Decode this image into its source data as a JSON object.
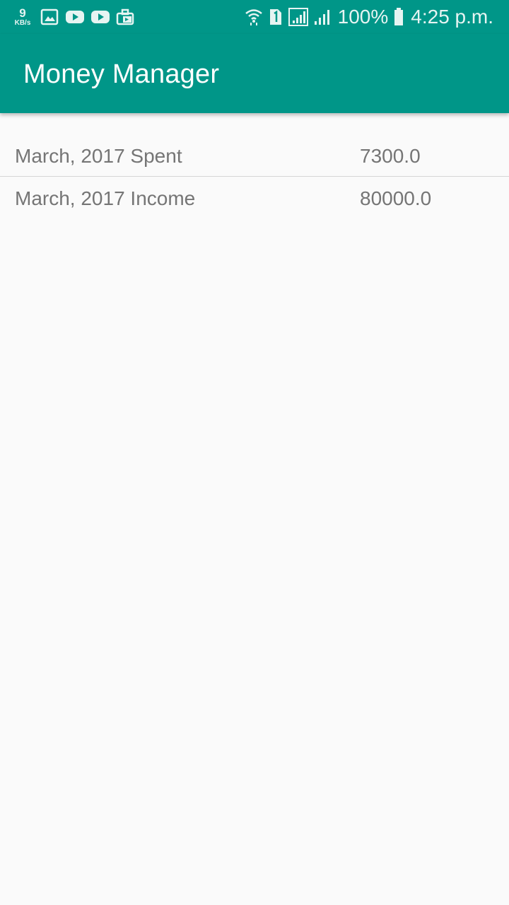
{
  "status_bar": {
    "speed_value": "9",
    "speed_unit": "KB/s",
    "left_icons": [
      "gallery-icon",
      "youtube-icon",
      "youtube-icon",
      "work-bag-icon"
    ],
    "right_icons": [
      "wifi-icon",
      "sim-1-icon",
      "signal-box-icon",
      "signal-bars-icon"
    ],
    "battery": "100%",
    "time": "4:25 p.m."
  },
  "app_bar": {
    "title": "Money Manager",
    "color": "#009688"
  },
  "summary": {
    "rows": [
      {
        "label": "March, 2017 Spent",
        "amount": "7300.0"
      },
      {
        "label": "March, 2017 Income",
        "amount": "80000.0"
      }
    ]
  }
}
